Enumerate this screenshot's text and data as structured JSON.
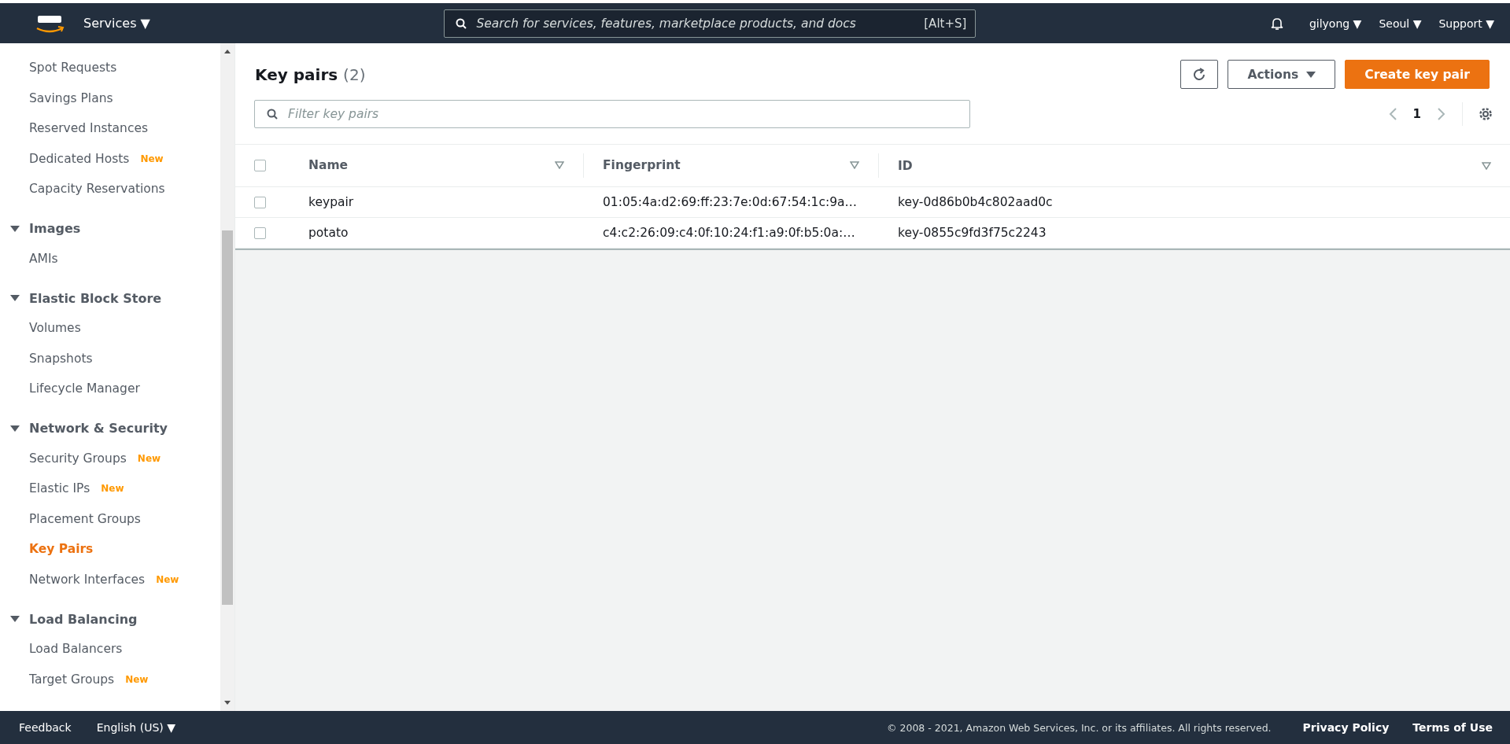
{
  "top_bar": {
    "services": "Services ▼",
    "search": {
      "placeholder": "Search for services, features, marketplace products, and docs",
      "shortcut": "[Alt+S]"
    },
    "menus": [
      "gilyong ▼",
      "Seoul ▼",
      "Support ▼"
    ]
  },
  "sidebar": {
    "items": [
      {
        "kind": "item",
        "label": "Spot Requests",
        "selected": false
      },
      {
        "kind": "item",
        "label": "Savings Plans",
        "selected": false
      },
      {
        "kind": "item",
        "label": "Reserved Instances",
        "selected": false
      },
      {
        "kind": "item",
        "label": "Dedicated Hosts",
        "badge": "New",
        "selected": false
      },
      {
        "kind": "item",
        "label": "Capacity Reservations",
        "selected": false
      },
      {
        "kind": "section",
        "label": "Images",
        "expanded": true
      },
      {
        "kind": "item",
        "label": "AMIs",
        "selected": false
      },
      {
        "kind": "section",
        "label": "Elastic Block Store",
        "expanded": true
      },
      {
        "kind": "item",
        "label": "Volumes",
        "selected": false
      },
      {
        "kind": "item",
        "label": "Snapshots",
        "selected": false
      },
      {
        "kind": "item",
        "label": "Lifecycle Manager",
        "selected": false
      },
      {
        "kind": "section",
        "label": "Network & Security",
        "expanded": true
      },
      {
        "kind": "item",
        "label": "Security Groups",
        "badge": "New",
        "selected": false
      },
      {
        "kind": "item",
        "label": "Elastic IPs",
        "badge": "New",
        "selected": false
      },
      {
        "kind": "item",
        "label": "Placement Groups",
        "selected": false
      },
      {
        "kind": "item",
        "label": "Key Pairs",
        "selected": true
      },
      {
        "kind": "item",
        "label": "Network Interfaces",
        "badge": "New",
        "selected": false
      },
      {
        "kind": "section",
        "label": "Load Balancing",
        "expanded": true
      },
      {
        "kind": "item",
        "label": "Load Balancers",
        "selected": false
      },
      {
        "kind": "item",
        "label": "Target Groups",
        "badge": "New",
        "selected": false
      }
    ]
  },
  "panel": {
    "title": "Key pairs",
    "count": "(2)",
    "actions": "Actions",
    "create": "Create key pair",
    "filter": {
      "placeholder": "Filter key pairs"
    },
    "page": "1",
    "table": {
      "select_all": {
        "checked": false
      },
      "columns": [
        "Name",
        "Fingerprint",
        "ID"
      ],
      "rows": [
        {
          "checked": false,
          "cells": [
            "keypair",
            "01:05:4a:d2:69:ff:23:7e:0d:67:54:1c:9a…",
            "key-0d86b0b4c802aad0c"
          ]
        },
        {
          "checked": false,
          "cells": [
            "potato",
            "c4:c2:26:09:c4:0f:10:24:f1:a9:0f:b5:0a:…",
            "key-0855c9fd3f75c2243"
          ]
        }
      ]
    }
  },
  "footer": {
    "feedback": "Feedback",
    "language": "English (US) ▼",
    "copyright": "© 2008 - 2021, Amazon Web Services, Inc. or its affiliates. All rights reserved.",
    "links": [
      "Privacy Policy",
      "Terms of Use"
    ]
  }
}
